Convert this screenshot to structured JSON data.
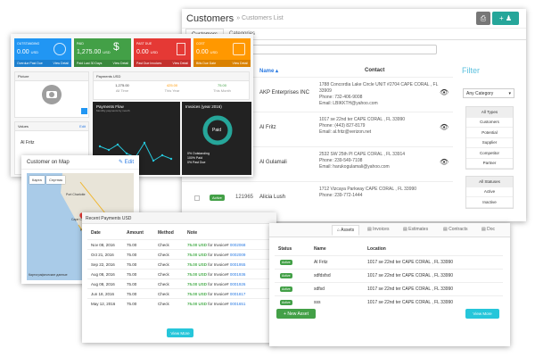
{
  "customers": {
    "title": "Customers",
    "breadcrumb": "» Customers List",
    "tabs": [
      "Customers",
      "Categories"
    ],
    "col_name": "Name ▴",
    "col_contact": "Contact",
    "col_id": "m",
    "rows": [
      {
        "id": "285",
        "name": "AKP Enterprises INC",
        "addr": [
          "1788 Concordia Lake Circle UNIT #2704 CAPE CORAL , FL",
          "33909",
          "Phone: 732-406-9008",
          "Email: LBIKKTH@yahoo.com"
        ]
      },
      {
        "id": "285",
        "name": "Al Fritz",
        "addr": [
          "1017 se 22nd ter CAPE CORAL , FL 33990",
          "Phone: (443) 827-8179",
          "Email: al.fritz@verizon.net"
        ]
      },
      {
        "id": "964",
        "name": "Al Gulamali",
        "addr": [
          "2532 SW 25th Pl CAPE CORAL , FL 33914",
          "Phone: 239-549-7108",
          "Email: harukogulamali@yahoo.com"
        ]
      },
      {
        "id": "121965",
        "name": "Alicia Lush",
        "badge": "Active",
        "addr": [
          "1712 Vizcaya Parkway CAPE CORAL , FL 33990",
          "Phone: 239-772-1444"
        ]
      }
    ],
    "filter": {
      "title": "Filter",
      "select": "Any Category",
      "types": [
        "All Types",
        "Customers",
        "Potential",
        "Supplier",
        "Competitor",
        "Partner"
      ],
      "statuses": [
        "All Statuses",
        "Active",
        "Inactive"
      ]
    }
  },
  "dashboard": {
    "tiles": [
      {
        "label": "OUTSTANDING",
        "value": "0.00",
        "unit": "USD",
        "foot": "Overdue Past Due",
        "link": "View Detail",
        "color": "#2196f3"
      },
      {
        "label": "PAID",
        "value": "1,275.00",
        "unit": "USD",
        "foot": "Paid Last 30 Days",
        "link": "View Detail",
        "color": "#43a047"
      },
      {
        "label": "PAST DUE",
        "value": "0.00",
        "unit": "USD",
        "foot": "Past Due Invoices",
        "link": "View Detail",
        "color": "#e53935"
      },
      {
        "label": "COST",
        "value": "0.00",
        "unit": "USD",
        "foot": "Bills Due Date",
        "link": "View Detail",
        "color": "#ff9800"
      }
    ],
    "picture_title": "Picture",
    "payments_title": "Payments USD",
    "stats": [
      {
        "value": "1,275.00",
        "label": "All Time"
      },
      {
        "value": "425.00",
        "label": "This Year"
      },
      {
        "value": "75.00",
        "label": "This Month"
      }
    ],
    "values_title": "Values",
    "values_edit": "Edit",
    "values_name": "Al Fritz",
    "flow_title": "Payments Flow",
    "flow_sub": "Monthly payments by month",
    "invoices_title": "Invoices (year 2016)",
    "donut_label": "Paid",
    "legend": [
      "0% Outstanding",
      "100% Paid",
      "0% Past Due"
    ]
  },
  "map": {
    "title": "Customer on Map",
    "edit": "Edit",
    "controls": [
      "Карта",
      "Спутник"
    ],
    "labels": [
      "Port Charlotte",
      "Cape Coral",
      "Fort Myers",
      "Naples"
    ],
    "footer": "Картографические данные"
  },
  "payments": {
    "title": "Recent Payments USD",
    "cols": [
      "Date",
      "Amount",
      "Method",
      "Note"
    ],
    "rows": [
      {
        "date": "Nov 08, 2016",
        "amount": "75.00",
        "method": "Check",
        "note_amt": "75.00 USD",
        "note_mid": "for Invoice#",
        "inv": "0002068"
      },
      {
        "date": "Oct 21, 2016",
        "amount": "75.00",
        "method": "Check",
        "note_amt": "75.00 USD",
        "note_mid": "for Invoice#",
        "inv": "0002009"
      },
      {
        "date": "Sep 22, 2016",
        "amount": "75.00",
        "method": "Check",
        "note_amt": "75.00 USD",
        "note_mid": "for Invoice#",
        "inv": "0001955"
      },
      {
        "date": "Aug 08, 2016",
        "amount": "75.00",
        "method": "Check",
        "note_amt": "75.00 USD",
        "note_mid": "for Invoice#",
        "inv": "0001936"
      },
      {
        "date": "Aug 08, 2016",
        "amount": "75.00",
        "method": "Check",
        "note_amt": "75.00 USD",
        "note_mid": "for Invoice#",
        "inv": "0001926"
      },
      {
        "date": "Jun 18, 2016",
        "amount": "75.00",
        "method": "Check",
        "note_amt": "75.00 USD",
        "note_mid": "for Invoice#",
        "inv": "0001817"
      },
      {
        "date": "May 12, 2016",
        "amount": "75.00",
        "method": "Check",
        "note_amt": "75.00 USD",
        "note_mid": "for Invoice#",
        "inv": "0001651"
      }
    ],
    "view_more": "View More"
  },
  "assets": {
    "tabs": [
      "Assets",
      "Invoices",
      "Estimates",
      "Contracts",
      "Doc"
    ],
    "cols": [
      "Status",
      "Name",
      "Location"
    ],
    "rows": [
      {
        "status": "Active",
        "name": "Al Fritz",
        "location": "1017 se 22nd ter CAPE CORAL , FL 33990"
      },
      {
        "status": "Active",
        "name": "sdfdsfsd",
        "location": "1017 se 22nd ter CAPE CORAL , FL 33990"
      },
      {
        "status": "Active",
        "name": "sdfsd",
        "location": "1017 se 22nd ter CAPE CORAL , FL 33990"
      },
      {
        "status": "Active",
        "name": "sss",
        "location": "1017 se 22nd ter CAPE CORAL , FL 33990"
      }
    ],
    "new_asset": "+ New Asset",
    "view_more": "View More"
  }
}
